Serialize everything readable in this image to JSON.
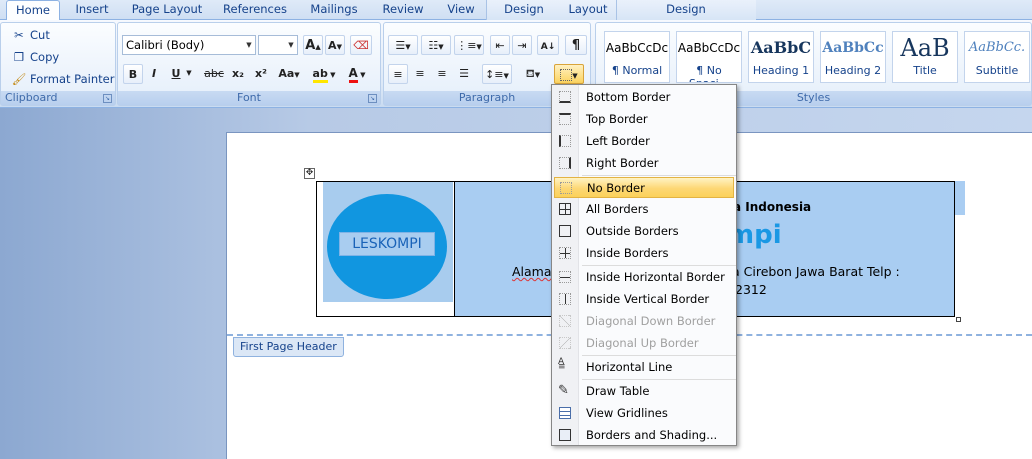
{
  "tabs": {
    "home": "Home",
    "insert": "Insert",
    "page_layout": "Page Layout",
    "references": "References",
    "mailings": "Mailings",
    "review": "Review",
    "view": "View",
    "design": "Design",
    "layout": "Layout",
    "context_design": "Design"
  },
  "clipboard": {
    "cut": "Cut",
    "copy": "Copy",
    "format_painter": "Format Painter",
    "label": "Clipboard"
  },
  "font": {
    "name": "Calibri (Body)",
    "size": "",
    "label": "Font",
    "bold": "B",
    "italic": "I",
    "underline": "U",
    "strike": "abc",
    "subscript": "x₂",
    "superscript": "x²",
    "change_case": "Aa",
    "grow": "A",
    "shrink": "A",
    "highlight": "ab",
    "font_color": "A"
  },
  "paragraph": {
    "label": "Paragraph"
  },
  "styles": {
    "label": "Styles",
    "items": [
      {
        "sample": "AaBbCcDc",
        "name": "¶ Normal"
      },
      {
        "sample": "AaBbCcDc",
        "name": "¶ No Spaci..."
      },
      {
        "sample": "AaBbC",
        "name": "Heading 1"
      },
      {
        "sample": "AaBbCc",
        "name": "Heading 2"
      },
      {
        "sample": "AaB",
        "name": "Title"
      },
      {
        "sample": "AaBbCc.",
        "name": "Subtitle"
      }
    ]
  },
  "document": {
    "header_tag": "First Page Header",
    "logo_text": "LESKOMPI",
    "title_text": "a Indonesia",
    "big_text": "mpi",
    "address_line1_left": "Alamat",
    "address_line1_right": "a Cirebon Jawa Barat Telp :",
    "address_line2": "2312"
  },
  "border_menu": {
    "items": [
      {
        "label": "Bottom Border",
        "disabled": false
      },
      {
        "label": "Top Border",
        "disabled": false
      },
      {
        "label": "Left Border",
        "disabled": false
      },
      {
        "label": "Right Border",
        "disabled": false
      },
      {
        "label": "No Border",
        "disabled": false
      },
      {
        "label": "All Borders",
        "disabled": false
      },
      {
        "label": "Outside Borders",
        "disabled": false
      },
      {
        "label": "Inside Borders",
        "disabled": false
      },
      {
        "label": "Inside Horizontal Border",
        "disabled": false
      },
      {
        "label": "Inside Vertical Border",
        "disabled": false
      },
      {
        "label": "Diagonal Down Border",
        "disabled": true
      },
      {
        "label": "Diagonal Up Border",
        "disabled": true
      },
      {
        "label": "Horizontal Line",
        "disabled": false
      },
      {
        "label": "Draw Table",
        "disabled": false
      },
      {
        "label": "View Gridlines",
        "disabled": false
      },
      {
        "label": "Borders and Shading...",
        "disabled": false
      }
    ],
    "highlighted": "No Border"
  },
  "colors": {
    "accent": "#15428b",
    "logo_blue": "#1196e0",
    "cell_blue": "#a9cdf2",
    "hover_gold": "#fdd775"
  }
}
